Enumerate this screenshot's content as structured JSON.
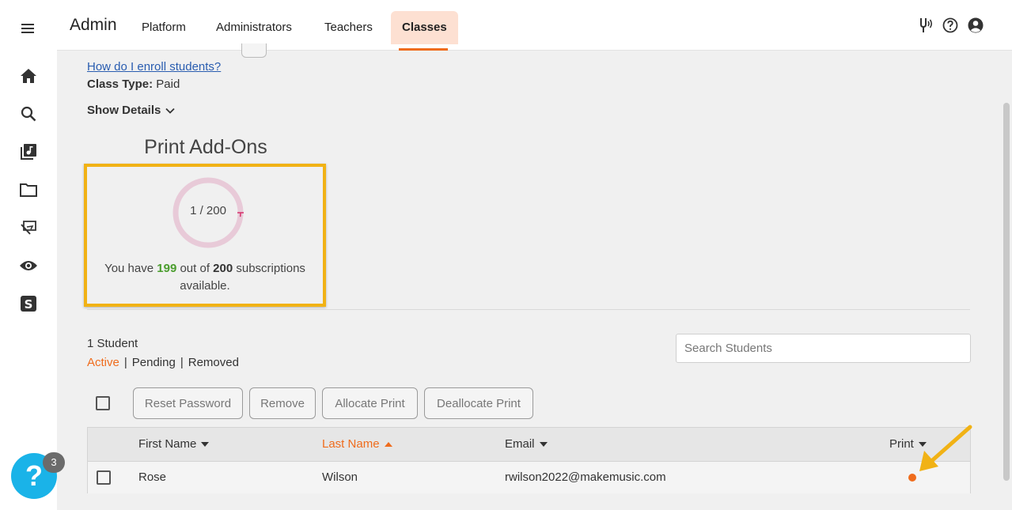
{
  "header": {
    "brand": "Admin",
    "tabs": [
      {
        "label": "Platform"
      },
      {
        "label": "Administrators"
      },
      {
        "label": "Teachers"
      },
      {
        "label": "Classes",
        "active": true
      }
    ],
    "icons": [
      "tuning-fork-icon",
      "help-circle-icon",
      "account-icon"
    ],
    "accent_color": "#ef6c1d"
  },
  "sidebar": {
    "icons": [
      "menu-icon",
      "home-icon",
      "search-icon",
      "music-library-icon",
      "folder-icon",
      "assignment-icon",
      "visibility-icon",
      "smartmusic-icon"
    ]
  },
  "class_info": {
    "enroll_link": "How do I enroll students?",
    "class_type_label": "Class Type:",
    "class_type_value": "Paid",
    "show_details": "Show Details"
  },
  "print_addons": {
    "title": "Print Add-Ons",
    "gauge_text": "1 / 200",
    "used": 1,
    "total": 200,
    "desc_prefix": "You have",
    "available": "199",
    "desc_mid": "out of",
    "total_text": "200",
    "desc_suffix": "subscriptions available.",
    "highlight_color": "#f1b215"
  },
  "students": {
    "count_text": "1 Student",
    "filters": [
      {
        "label": "Active",
        "active": true
      },
      {
        "label": "Pending"
      },
      {
        "label": "Removed"
      }
    ],
    "search_placeholder": "Search Students",
    "actions": [
      {
        "label": "Reset Password"
      },
      {
        "label": "Remove"
      },
      {
        "label": "Allocate Print"
      },
      {
        "label": "Deallocate Print"
      }
    ],
    "columns": [
      {
        "label": "First Name",
        "sort": "desc"
      },
      {
        "label": "Last Name",
        "sort": "asc",
        "active": true
      },
      {
        "label": "Email",
        "sort": "desc"
      },
      {
        "label": "Print",
        "sort": "desc"
      }
    ],
    "rows": [
      {
        "first_name": "Rose",
        "last_name": "Wilson",
        "email": "rwilson2022@makemusic.com",
        "print": "allocated"
      }
    ]
  },
  "help_widget": {
    "glyph": "?",
    "badge": "3"
  }
}
